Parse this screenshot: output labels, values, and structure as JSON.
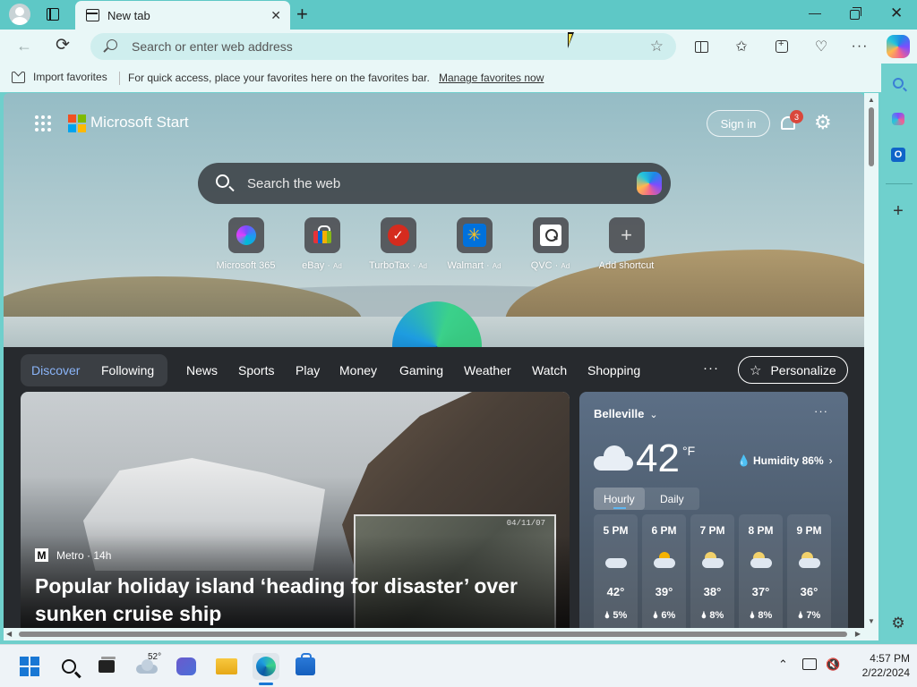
{
  "browser": {
    "tab": {
      "title": "New tab"
    },
    "address_bar": {
      "placeholder": "Search or enter web address"
    },
    "favorites_bar": {
      "import_label": "Import favorites",
      "hint": "For quick access, place your favorites here on the favorites bar.",
      "manage_link": "Manage favorites now"
    },
    "icons": {
      "back": "back-arrow-icon",
      "refresh": "refresh-icon",
      "favorite": "star-icon",
      "split": "split-screen-icon",
      "favorites": "favorites-icon",
      "collections": "collections-icon",
      "performance": "performance-icon",
      "more": "more-icon",
      "copilot": "copilot-icon"
    },
    "glyphs": {
      "back": "←",
      "refresh": "⟳",
      "star": "☆",
      "favs": "✩",
      "more": "···",
      "perf": "♡",
      "close": "✕",
      "plus": "+",
      "min": "—"
    }
  },
  "sidebar": {
    "items": [
      "search-icon",
      "copilot-icon",
      "outlook-icon",
      "add-icon",
      "settings-icon"
    ],
    "glyphs": {
      "outlook": "O",
      "add": "+",
      "settings": "⚙"
    }
  },
  "start_page": {
    "brand": "Microsoft Start",
    "brand_colors": [
      "#f25022",
      "#7fba00",
      "#00a4ef",
      "#ffb900"
    ],
    "sign_in": "Sign in",
    "notifications_count": "3",
    "search_placeholder": "Search the web",
    "shortcuts": [
      {
        "label": "Microsoft 365",
        "ad": ""
      },
      {
        "label": "eBay",
        "ad": "Ad"
      },
      {
        "label": "TurboTax",
        "ad": "Ad"
      },
      {
        "label": "Walmart",
        "ad": "Ad"
      },
      {
        "label": "QVC",
        "ad": "Ad"
      },
      {
        "label": "Add shortcut",
        "ad": ""
      }
    ],
    "shortcut_glyphs": {
      "turbotax": "✓",
      "walmart": "✳",
      "add": "+"
    },
    "feed_nav": {
      "pills": [
        "Discover",
        "Following"
      ],
      "items": [
        "News",
        "Sports",
        "Play",
        "Money",
        "Gaming",
        "Weather",
        "Watch",
        "Shopping"
      ],
      "more": "···",
      "personalize": "Personalize",
      "personalize_glyph": "☆"
    },
    "hero": {
      "source": "Metro",
      "age": "· 14h",
      "source_logo": "M",
      "headline": "Popular holiday island ‘heading for disaster’ over sunken cruise ship",
      "inset_stamp": "04/11/07"
    },
    "weather": {
      "city": "Belleville",
      "city_chevron": "⌄",
      "more": "···",
      "temp": "42",
      "unit": "°F",
      "humidity": "Humidity 86%",
      "humidity_glyph": "💧",
      "humidity_arrow": "›",
      "tabs": [
        "Hourly",
        "Daily"
      ],
      "hours": [
        {
          "time": "5 PM",
          "icon": "cloudy-icon",
          "temp": "42°",
          "precip": "🌢 5%"
        },
        {
          "time": "6 PM",
          "icon": "partly-cloudy-icon",
          "temp": "39°",
          "precip": "🌢 6%"
        },
        {
          "time": "7 PM",
          "icon": "partly-cloudy-night-icon",
          "temp": "38°",
          "precip": "🌢 8%"
        },
        {
          "time": "8 PM",
          "icon": "partly-cloudy-night-icon",
          "temp": "37°",
          "precip": "🌢 8%"
        },
        {
          "time": "9 PM",
          "icon": "partly-cloudy-night-icon",
          "temp": "36°",
          "precip": "🌢 7%"
        }
      ]
    }
  },
  "taskbar": {
    "weather_temp": "52°",
    "tray_chevron": "⌃",
    "tray_volume": "🔇",
    "clock": {
      "time": "4:57 PM",
      "date": "2/22/2024"
    }
  }
}
